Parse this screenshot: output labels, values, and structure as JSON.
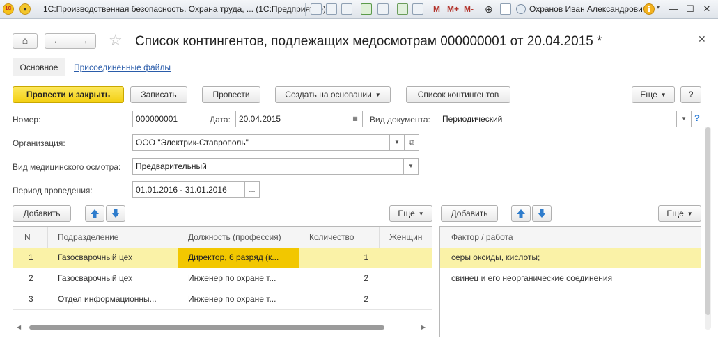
{
  "titlebar": {
    "logo": "1С",
    "title": "1С:Производственная безопасность. Охрана труда, ...  (1С:Предприятие)",
    "m_buttons": [
      "M",
      "M+",
      "M-"
    ],
    "user": "Охранов Иван Александрович",
    "info": "i"
  },
  "header": {
    "title": "Список контингентов, подлежащих медосмотрам 000000001 от 20.04.2015 *",
    "tabs": [
      "Основное",
      "Присоединенные файлы"
    ]
  },
  "toolbar": {
    "post_close": "Провести и закрыть",
    "save": "Записать",
    "post": "Провести",
    "create_based": "Создать на основании",
    "contingent_list": "Список контингентов",
    "more": "Еще",
    "help": "?"
  },
  "form": {
    "number_label": "Номер:",
    "number": "000000001",
    "date_label": "Дата:",
    "date": "20.04.2015",
    "doc_type_label": "Вид документа:",
    "doc_type": "Периодический",
    "org_label": "Организация:",
    "org": "ООО \"Электрик-Ставрополь\"",
    "exam_type_label": "Вид медицинского осмотра:",
    "exam_type": "Предварительный",
    "period_label": "Период проведения:",
    "period": "01.01.2016 - 31.01.2016",
    "ellipsis": "...",
    "help_mark": "?"
  },
  "left_table": {
    "add": "Добавить",
    "more": "Еще",
    "columns": [
      "N",
      "Подразделение",
      "Должность (профессия)",
      "Количество",
      "Женщин"
    ],
    "rows": [
      [
        "1",
        "Газосварочный цех",
        "Директор, 6 разряд (к...",
        "1",
        ""
      ],
      [
        "2",
        "Газосварочный цех",
        "Инженер по охране т...",
        "2",
        ""
      ],
      [
        "3",
        "Отдел информационны...",
        "Инженер по охране т...",
        "2",
        ""
      ]
    ]
  },
  "right_table": {
    "add": "Добавить",
    "more": "Еще",
    "columns": [
      "Фактор / работа"
    ],
    "rows": [
      [
        "серы оксиды, кислоты;"
      ],
      [
        "свинец и его неорганические соединения"
      ]
    ]
  }
}
